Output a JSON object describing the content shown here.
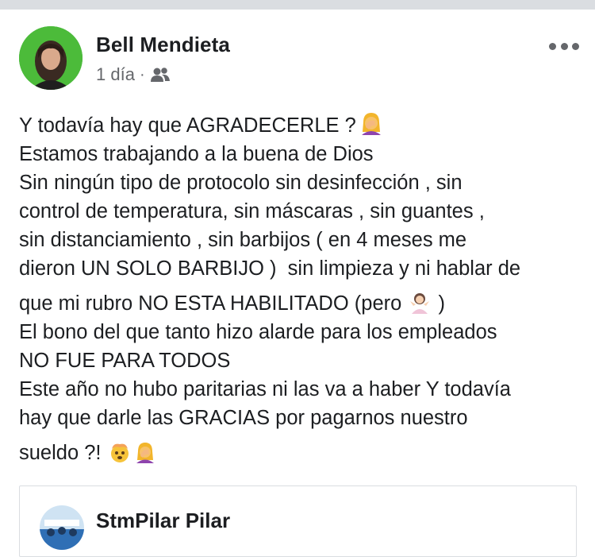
{
  "post": {
    "author": "Bell Mendieta",
    "time": "1 día",
    "separator": "·",
    "audience_icon": "friends-icon",
    "lines": [
      "Y todavía hay que AGRADECERLE ?",
      "Estamos trabajando a la buena de Dios",
      "Sin ningún tipo de protocolo sin desinfección , sin",
      "control de temperatura, sin máscaras , sin guantes ,",
      "sin distanciamiento , sin barbijos ( en 4 meses me",
      "dieron UN SOLO BARBIJO )  sin limpieza y ni hablar de",
      "que mi rubro NO ESTA HABILITADO (pero",
      ")",
      "El bono del que tanto hizo alarde para los empleados",
      "NO FUE PARA TODOS",
      "Este año no hubo paritarias ni las va a haber Y todavía",
      "hay que darle las GRACIAS por pagarnos nuestro",
      "sueldo ?!"
    ]
  },
  "shared_post": {
    "author": "StmPilar Pilar"
  },
  "colors": {
    "text": "#1c1e21",
    "secondary": "#65676b",
    "divider": "#dadde1",
    "avatar_bg": "#3cb043"
  }
}
